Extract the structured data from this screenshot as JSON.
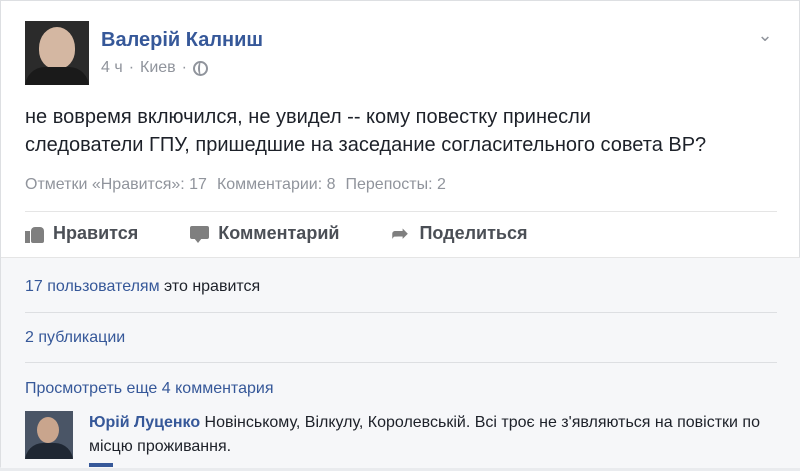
{
  "post": {
    "author": "Валерій Калниш",
    "time": "4 ч",
    "separator": "·",
    "location": "Киев",
    "text_line1": "не вовремя включился, не увидел -- кому повестку принесли",
    "text_line2": "следователи ГПУ, пришедшие на заседание согласительного совета ВР?"
  },
  "stats": {
    "likes": "Отметки «Нравится»: 17",
    "comments": "Комментарии: 8",
    "shares": "Перепосты: 2"
  },
  "actions": {
    "like": "Нравится",
    "comment": "Комментарий",
    "share": "Поделиться"
  },
  "feedback": {
    "likers_link": "17 пользователям",
    "likers_suffix": " это нравится",
    "publications": "2 публикации",
    "view_more": "Просмотреть еще 4 комментария"
  },
  "comment": {
    "author": "Юрій Луценко",
    "text": " Новінському, Вілкулу, Королевській. Всі троє не з'являються на повістки по місцю проживання."
  },
  "icons": {
    "chevron": "chevron-down-icon",
    "globe": "globe-icon",
    "like": "like-icon",
    "comment": "comment-icon",
    "share": "share-icon"
  }
}
